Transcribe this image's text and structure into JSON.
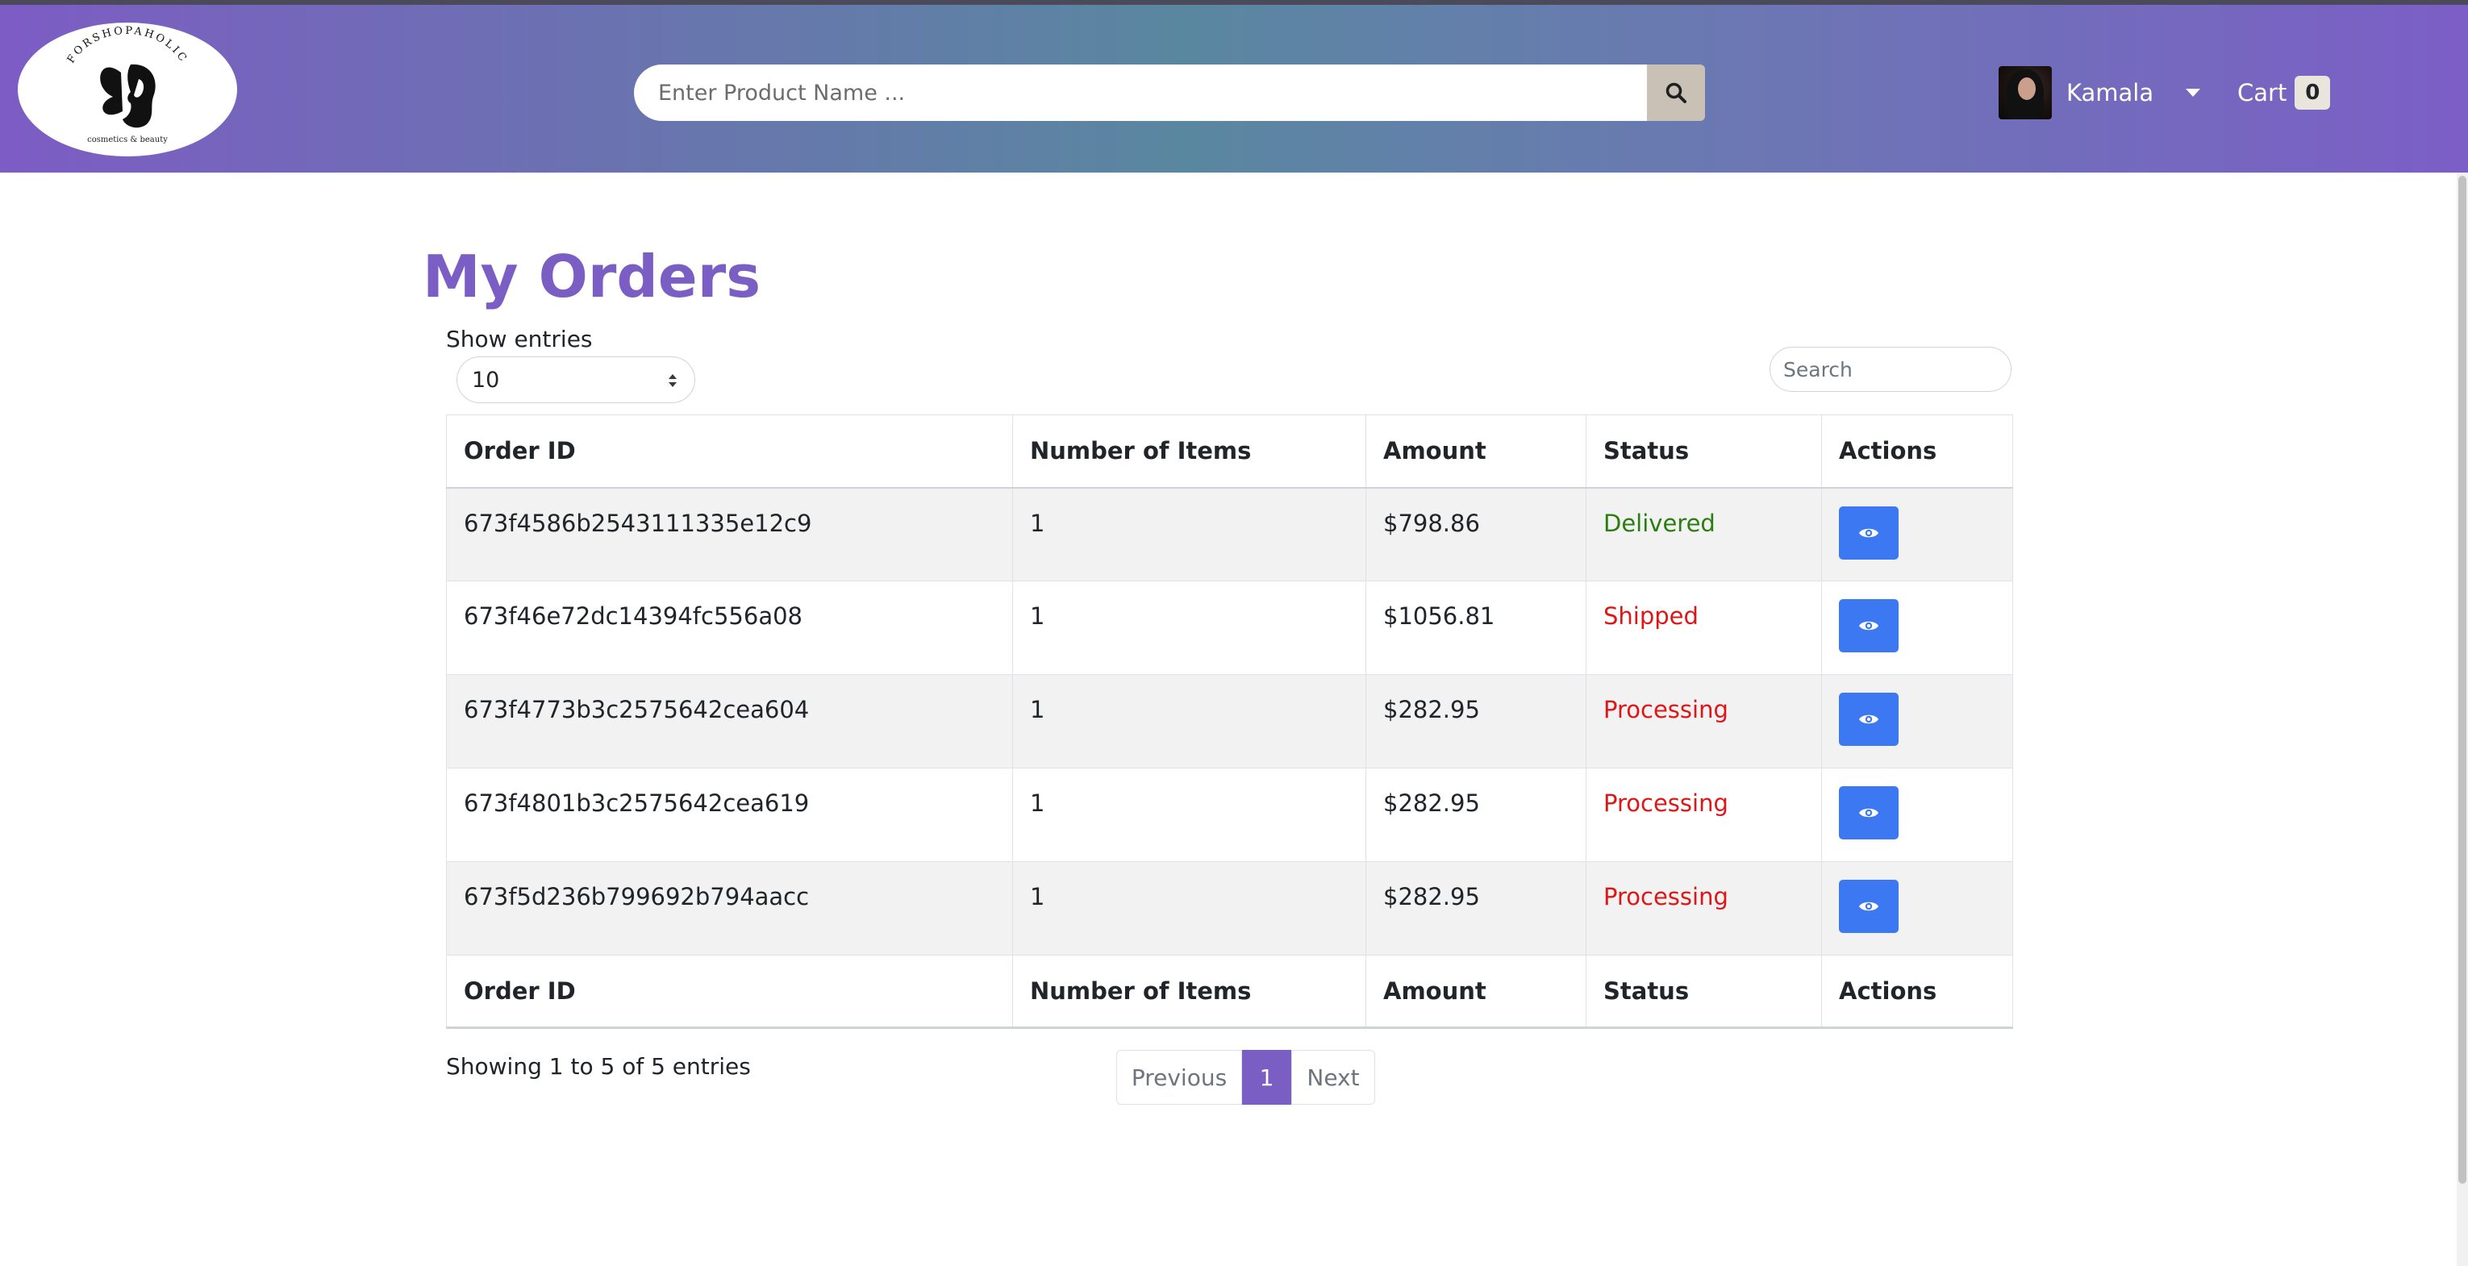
{
  "header": {
    "logo": {
      "brand": "FORSHOPAHOLIC",
      "tagline": "cosmetics & beauty"
    },
    "search": {
      "placeholder": "Enter Product Name ..."
    },
    "user": {
      "name": "Kamala"
    },
    "cart": {
      "label": "Cart",
      "count": "0"
    }
  },
  "page": {
    "title": "My Orders",
    "show_entries_label": "Show entries",
    "entries_value": "10",
    "table_search_placeholder": "Search"
  },
  "table": {
    "columns": [
      "Order ID",
      "Number of Items",
      "Amount",
      "Status",
      "Actions"
    ],
    "rows": [
      {
        "order_id": "673f4586b2543111335e12c9",
        "items": "1",
        "amount": "$798.86",
        "status": "Delivered"
      },
      {
        "order_id": "673f46e72dc14394fc556a08",
        "items": "1",
        "amount": "$1056.81",
        "status": "Shipped"
      },
      {
        "order_id": "673f4773b3c2575642cea604",
        "items": "1",
        "amount": "$282.95",
        "status": "Processing"
      },
      {
        "order_id": "673f4801b3c2575642cea619",
        "items": "1",
        "amount": "$282.95",
        "status": "Processing"
      },
      {
        "order_id": "673f5d236b799692b794aacc",
        "items": "1",
        "amount": "$282.95",
        "status": "Processing"
      }
    ]
  },
  "footer": {
    "info": "Showing 1 to 5 of 5 entries",
    "pagination": {
      "previous": "Previous",
      "current": "1",
      "next": "Next"
    }
  },
  "colors": {
    "accent": "#7b5ec4",
    "view_button": "#3b78f2",
    "status_delivered": "#2b7d10",
    "status_other": "#dd1717"
  },
  "icons": {
    "search": "search-icon",
    "view": "eye-icon",
    "dropdown": "caret-down-icon"
  }
}
